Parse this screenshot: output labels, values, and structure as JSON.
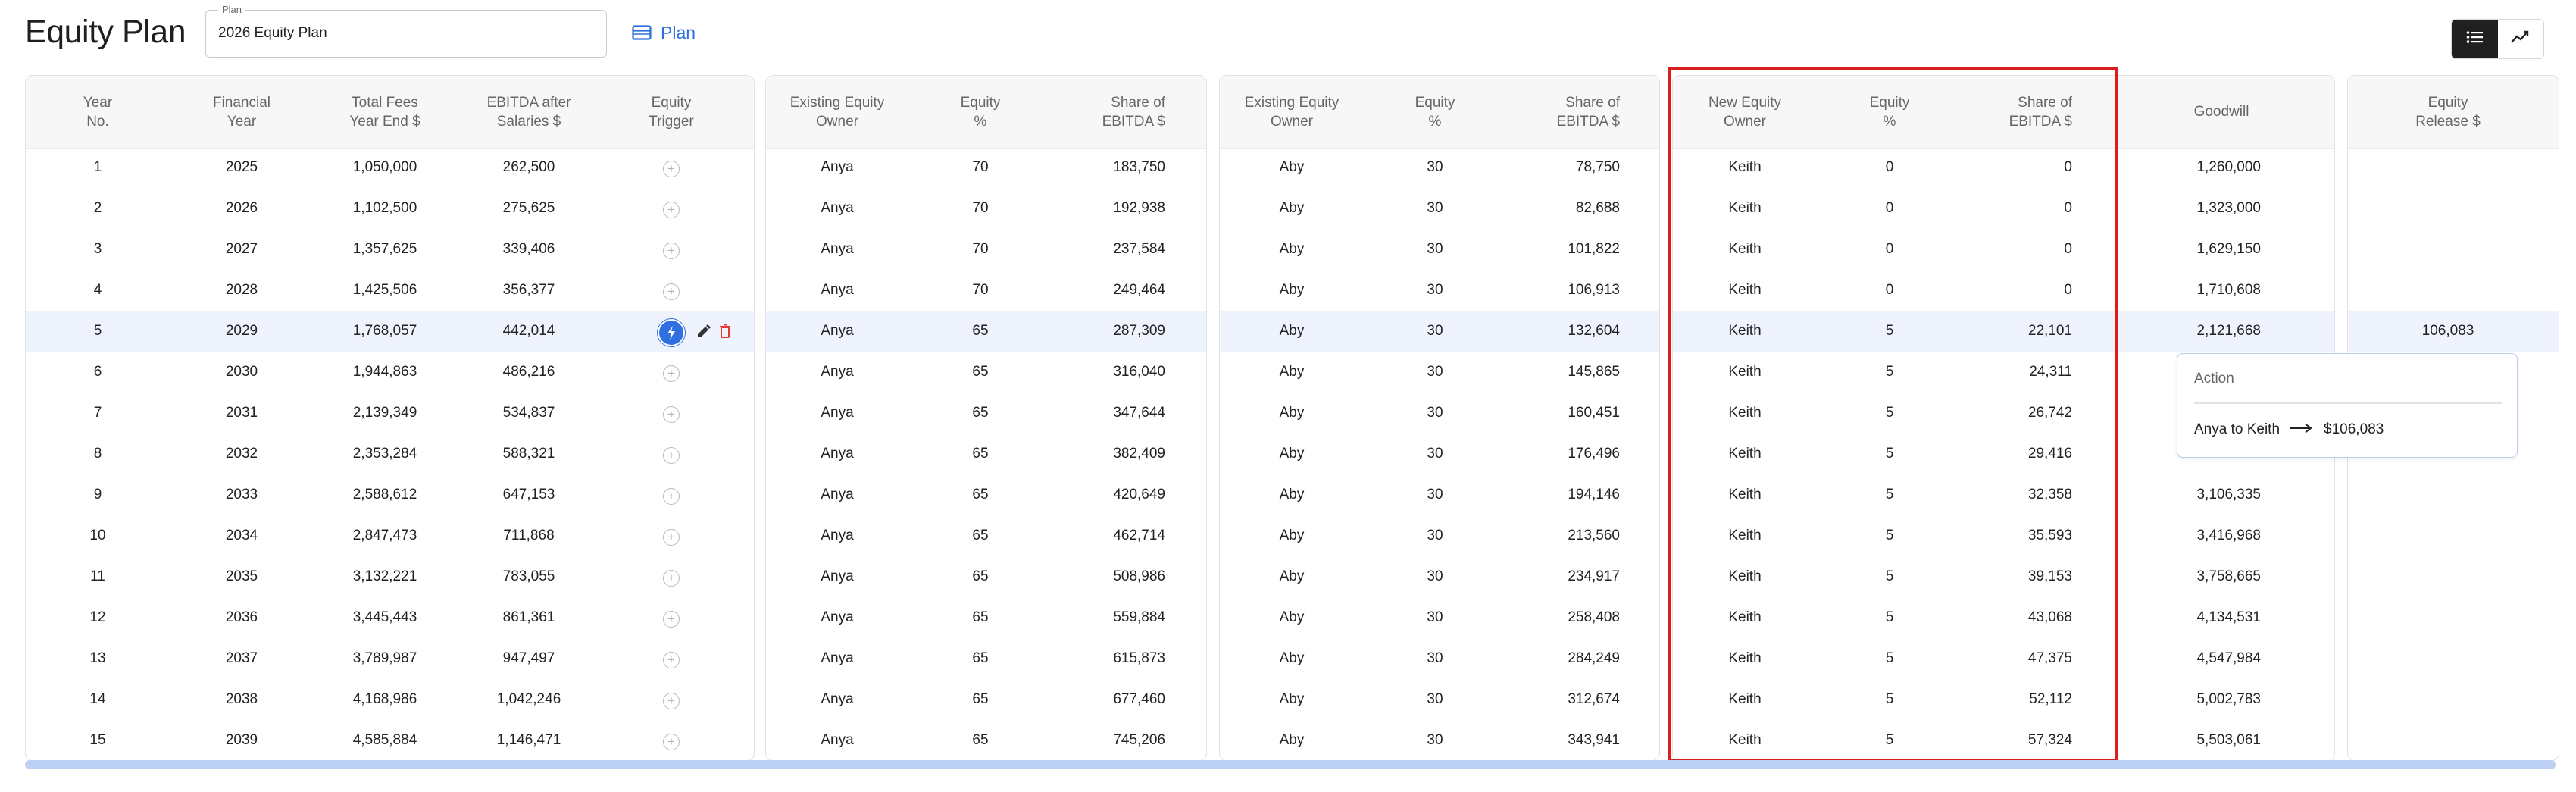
{
  "page": {
    "title": "Equity Plan"
  },
  "plan_select": {
    "label": "Plan",
    "value": "2026 Equity Plan"
  },
  "plan_link": {
    "label": "Plan",
    "icon": "card-icon"
  },
  "view_toggle": {
    "list_icon": "list-icon",
    "chart_icon": "trend-chart-icon",
    "active": "list"
  },
  "colors": {
    "accent": "#2f6fe0",
    "highlight_border": "#d91e1e",
    "highlight_row": "#eef3fd",
    "delete": "#e53935"
  },
  "headers": {
    "year_no": "Year\nNo.",
    "financial_year": "Financial\nYear",
    "total_fees": "Total Fees\nYear End $",
    "ebitda": "EBITDA after\nSalaries $",
    "equity_trigger": "Equity\nTrigger",
    "existing_owner_1": "Existing Equity\nOwner",
    "equity_pct_1": "Equity\n%",
    "share_1": "Share of\nEBITDA $",
    "existing_owner_2": "Existing Equity\nOwner",
    "equity_pct_2": "Equity\n%",
    "share_2": "Share of\nEBITDA $",
    "new_owner": "New Equity\nOwner",
    "equity_pct_3": "Equity\n%",
    "share_3": "Share of\nEBITDA $",
    "goodwill": "Goodwill",
    "equity_release": "Equity\nRelease $"
  },
  "rows": [
    {
      "no": "1",
      "fy": "2025",
      "fees": "1,050,000",
      "ebitda": "262,500",
      "o1": "Anya",
      "p1": "70",
      "s1": "183,750",
      "o2": "Aby",
      "p2": "30",
      "s2": "78,750",
      "o3": "Keith",
      "p3": "0",
      "s3": "0",
      "goodwill": "1,260,000",
      "release": ""
    },
    {
      "no": "2",
      "fy": "2026",
      "fees": "1,102,500",
      "ebitda": "275,625",
      "o1": "Anya",
      "p1": "70",
      "s1": "192,938",
      "o2": "Aby",
      "p2": "30",
      "s2": "82,688",
      "o3": "Keith",
      "p3": "0",
      "s3": "0",
      "goodwill": "1,323,000",
      "release": ""
    },
    {
      "no": "3",
      "fy": "2027",
      "fees": "1,357,625",
      "ebitda": "339,406",
      "o1": "Anya",
      "p1": "70",
      "s1": "237,584",
      "o2": "Aby",
      "p2": "30",
      "s2": "101,822",
      "o3": "Keith",
      "p3": "0",
      "s3": "0",
      "goodwill": "1,629,150",
      "release": ""
    },
    {
      "no": "4",
      "fy": "2028",
      "fees": "1,425,506",
      "ebitda": "356,377",
      "o1": "Anya",
      "p1": "70",
      "s1": "249,464",
      "o2": "Aby",
      "p2": "30",
      "s2": "106,913",
      "o3": "Keith",
      "p3": "0",
      "s3": "0",
      "goodwill": "1,710,608",
      "release": ""
    },
    {
      "no": "5",
      "fy": "2029",
      "fees": "1,768,057",
      "ebitda": "442,014",
      "o1": "Anya",
      "p1": "65",
      "s1": "287,309",
      "o2": "Aby",
      "p2": "30",
      "s2": "132,604",
      "o3": "Keith",
      "p3": "5",
      "s3": "22,101",
      "goodwill": "2,121,668",
      "release": "106,083"
    },
    {
      "no": "6",
      "fy": "2030",
      "fees": "1,944,863",
      "ebitda": "486,216",
      "o1": "Anya",
      "p1": "65",
      "s1": "316,040",
      "o2": "Aby",
      "p2": "30",
      "s2": "145,865",
      "o3": "Keith",
      "p3": "5",
      "s3": "24,311",
      "goodwill": "",
      "release": ""
    },
    {
      "no": "7",
      "fy": "2031",
      "fees": "2,139,349",
      "ebitda": "534,837",
      "o1": "Anya",
      "p1": "65",
      "s1": "347,644",
      "o2": "Aby",
      "p2": "30",
      "s2": "160,451",
      "o3": "Keith",
      "p3": "5",
      "s3": "26,742",
      "goodwill": "",
      "release": ""
    },
    {
      "no": "8",
      "fy": "2032",
      "fees": "2,353,284",
      "ebitda": "588,321",
      "o1": "Anya",
      "p1": "65",
      "s1": "382,409",
      "o2": "Aby",
      "p2": "30",
      "s2": "176,496",
      "o3": "Keith",
      "p3": "5",
      "s3": "29,416",
      "goodwill": "",
      "release": ""
    },
    {
      "no": "9",
      "fy": "2033",
      "fees": "2,588,612",
      "ebitda": "647,153",
      "o1": "Anya",
      "p1": "65",
      "s1": "420,649",
      "o2": "Aby",
      "p2": "30",
      "s2": "194,146",
      "o3": "Keith",
      "p3": "5",
      "s3": "32,358",
      "goodwill": "3,106,335",
      "release": ""
    },
    {
      "no": "10",
      "fy": "2034",
      "fees": "2,847,473",
      "ebitda": "711,868",
      "o1": "Anya",
      "p1": "65",
      "s1": "462,714",
      "o2": "Aby",
      "p2": "30",
      "s2": "213,560",
      "o3": "Keith",
      "p3": "5",
      "s3": "35,593",
      "goodwill": "3,416,968",
      "release": ""
    },
    {
      "no": "11",
      "fy": "2035",
      "fees": "3,132,221",
      "ebitda": "783,055",
      "o1": "Anya",
      "p1": "65",
      "s1": "508,986",
      "o2": "Aby",
      "p2": "30",
      "s2": "234,917",
      "o3": "Keith",
      "p3": "5",
      "s3": "39,153",
      "goodwill": "3,758,665",
      "release": ""
    },
    {
      "no": "12",
      "fy": "2036",
      "fees": "3,445,443",
      "ebitda": "861,361",
      "o1": "Anya",
      "p1": "65",
      "s1": "559,884",
      "o2": "Aby",
      "p2": "30",
      "s2": "258,408",
      "o3": "Keith",
      "p3": "5",
      "s3": "43,068",
      "goodwill": "4,134,531",
      "release": ""
    },
    {
      "no": "13",
      "fy": "2037",
      "fees": "3,789,987",
      "ebitda": "947,497",
      "o1": "Anya",
      "p1": "65",
      "s1": "615,873",
      "o2": "Aby",
      "p2": "30",
      "s2": "284,249",
      "o3": "Keith",
      "p3": "5",
      "s3": "47,375",
      "goodwill": "4,547,984",
      "release": ""
    },
    {
      "no": "14",
      "fy": "2038",
      "fees": "4,168,986",
      "ebitda": "1,042,246",
      "o1": "Anya",
      "p1": "65",
      "s1": "677,460",
      "o2": "Aby",
      "p2": "30",
      "s2": "312,674",
      "o3": "Keith",
      "p3": "5",
      "s3": "52,112",
      "goodwill": "5,002,783",
      "release": ""
    },
    {
      "no": "15",
      "fy": "2039",
      "fees": "4,585,884",
      "ebitda": "1,146,471",
      "o1": "Anya",
      "p1": "65",
      "s1": "745,206",
      "o2": "Aby",
      "p2": "30",
      "s2": "343,941",
      "o3": "Keith",
      "p3": "5",
      "s3": "57,324",
      "goodwill": "5,503,061",
      "release": ""
    }
  ],
  "active_trigger_row": 4,
  "popover": {
    "title": "Action",
    "from": "Anya to Keith",
    "amount": "$106,083"
  }
}
